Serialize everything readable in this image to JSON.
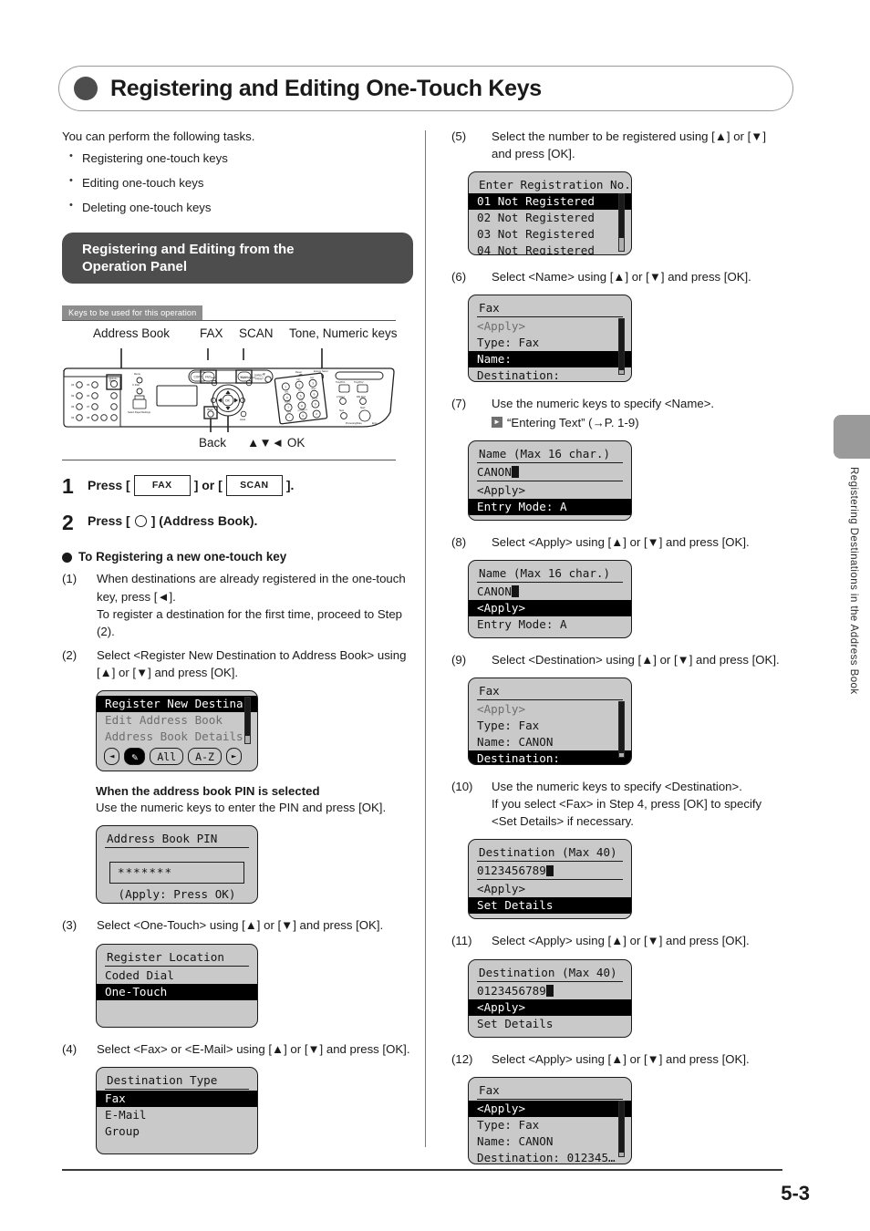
{
  "page": {
    "title": "Registering and Editing One-Touch Keys",
    "page_number": "5-3",
    "side_tab_text": "Registering Destinations in the Address Book"
  },
  "intro": {
    "lead": "You can perform the following tasks.",
    "items": [
      "Registering one-touch keys",
      "Editing one-touch keys",
      "Deleting one-touch keys"
    ]
  },
  "section": {
    "heading_line1": "Registering and Editing from the",
    "heading_line2": "Operation Panel"
  },
  "keys_legend": {
    "tag": "Keys to be used for this operation",
    "top_labels": {
      "address_book": "Address Book",
      "fax": "FAX",
      "scan": "SCAN",
      "tone_numeric": "Tone, Numeric keys"
    },
    "bottom_labels": {
      "back": "Back",
      "ok": "▲▼◄ OK"
    }
  },
  "big_steps": [
    {
      "num": "1",
      "pre": "Press [",
      "key1": "FAX",
      "mid": "] or [",
      "key2": "SCAN",
      "post": "]."
    },
    {
      "num": "2",
      "pre": "Press [",
      "post": "] (Address Book)."
    }
  ],
  "sub_head": "To Registering a new one-touch key",
  "left_steps": {
    "s1": {
      "marker": "(1)",
      "line1": "When destinations are already registered in the one-touch key, press [◄].",
      "line2": "To register a destination for the first time, proceed to Step (2)."
    },
    "s2": {
      "marker": "(2)",
      "text": "Select <Register New Destination to Address Book> using [▲] or [▼] and press [OK]."
    },
    "s3": {
      "marker": "(3)",
      "text": "Select <One-Touch> using [▲] or [▼] and press [OK]."
    },
    "s4": {
      "marker": "(4)",
      "text": "Select <Fax> or <E-Mail> using [▲] or [▼] and press [OK]."
    }
  },
  "pin_note": {
    "head": "When the address book PIN is selected",
    "body": "Use the numeric keys to enter the PIN and press [OK]."
  },
  "right_steps": {
    "s5": {
      "marker": "(5)",
      "text": "Select the number to be registered using [▲] or [▼] and press [OK]."
    },
    "s6": {
      "marker": "(6)",
      "text": "Select <Name> using [▲] or [▼] and press [OK]."
    },
    "s7": {
      "marker": "(7)",
      "text": "Use the numeric keys to specify <Name>.",
      "ref": "“Entering Text” (→P. 1-9)"
    },
    "s8": {
      "marker": "(8)",
      "text": "Select <Apply> using [▲] or [▼] and press [OK]."
    },
    "s9": {
      "marker": "(9)",
      "text": "Select <Destination> using [▲] or [▼] and press [OK]."
    },
    "s10": {
      "marker": "(10)",
      "line1": "Use the numeric keys to specify <Destination>.",
      "line2": "If you select <Fax> in Step 4, press [OK] to specify <Set Details> if necessary."
    },
    "s11": {
      "marker": "(11)",
      "text": "Select <Apply> using [▲] or [▼] and press [OK]."
    },
    "s12": {
      "marker": "(12)",
      "text": "Select <Apply> using [▲] or [▼] and press [OK]."
    }
  },
  "screens": {
    "register_new": {
      "row1": "Register New Destina",
      "row2": "Edit Address Book",
      "row3": "Address Book Details",
      "btn_left": "◄",
      "btn_edit": "✎",
      "btn_all": "All",
      "btn_az": "A-Z",
      "btn_right": "►"
    },
    "address_book_pin": {
      "title": "Address Book PIN",
      "value": "*******",
      "hint": "(Apply: Press OK)"
    },
    "register_location": {
      "title": "Register Location",
      "row1": "Coded Dial",
      "row2": "One-Touch"
    },
    "destination_type": {
      "title": "Destination Type",
      "row1": "Fax",
      "row2": "E-Mail",
      "row3": "Group"
    },
    "enter_registration_no": {
      "title": "Enter Registration No.",
      "row1": "01 Not Registered",
      "row2": "02 Not Registered",
      "row3": "03 Not Registered",
      "row4": "04 Not Registered"
    },
    "fax_name_sel": {
      "title": "Fax",
      "row1": "<Apply>",
      "row2": "Type: Fax",
      "row3": "Name:",
      "row4": "Destination:"
    },
    "name_entry": {
      "title": "Name (Max 16 char.)",
      "value": "CANON",
      "row_apply": "<Apply>",
      "row_mode": "Entry Mode: A"
    },
    "name_apply": {
      "title": "Name (Max 16 char.)",
      "value": "CANON",
      "row_apply": "<Apply>",
      "row_mode": "Entry Mode: A"
    },
    "fax_dest_sel": {
      "title": "Fax",
      "row1": "<Apply>",
      "row2": "Type: Fax",
      "row3": "Name: CANON",
      "row4": "Destination:"
    },
    "destination_entry": {
      "title": "Destination (Max 40)",
      "value": "0123456789",
      "row_apply": "<Apply>",
      "row_details": "Set Details"
    },
    "destination_apply": {
      "title": "Destination (Max 40)",
      "value": "0123456789",
      "row_apply": "<Apply>",
      "row_details": "Set Details"
    },
    "fax_final": {
      "title": "Fax",
      "row1": "<Apply>",
      "row2": "Type: Fax",
      "row3": "Name: CANON",
      "row4": "Destination: 012345…"
    }
  }
}
